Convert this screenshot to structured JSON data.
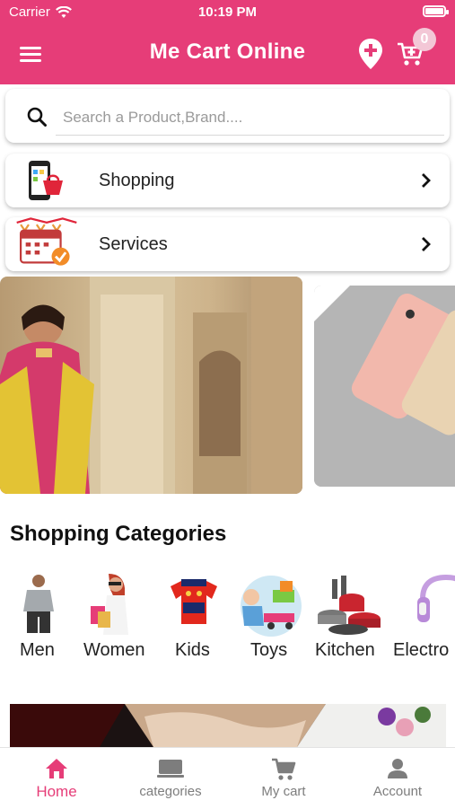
{
  "status": {
    "carrier": "Carrier",
    "time": "10:19 PM"
  },
  "appbar": {
    "title": "Me Cart Online",
    "cart_count": "0"
  },
  "search": {
    "placeholder": "Search a Product,Brand...."
  },
  "menu_cards": [
    {
      "label": "Shopping"
    },
    {
      "label": "Services"
    }
  ],
  "categories": {
    "title": "Shopping Categories",
    "items": [
      {
        "name": "Men"
      },
      {
        "name": "Women"
      },
      {
        "name": "Kids"
      },
      {
        "name": "Toys"
      },
      {
        "name": "Kitchen"
      },
      {
        "name": "Electro"
      }
    ]
  },
  "bottom_nav": {
    "items": [
      {
        "label": "Home",
        "icon": "home-icon"
      },
      {
        "label": "categories",
        "icon": "categories-icon"
      },
      {
        "label": "My cart",
        "icon": "cart-icon"
      },
      {
        "label": "Account",
        "icon": "account-icon"
      }
    ]
  },
  "colors": {
    "brand": "#e63d78",
    "inactive": "#7d7d7d"
  }
}
